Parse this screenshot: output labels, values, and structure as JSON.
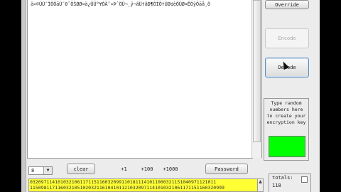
{
  "editor": {
    "content_line": "ä»©ÜÜ˜ÏÕÕāÜ˜θˆÕŠØØ¤ä¿ÜÜ°¥ÒÃ˜»ÞˆÖÜ¬¸ÿ¬ãÜ†ãÐ¶ÕÏÕ†ÜØ¢èÖÜØ¤ÊÖÿÕāå¸ð"
  },
  "buttons": {
    "override": "Override",
    "encode": "Encode",
    "decode": "Decode",
    "clear": "clear",
    "plus1": "+1",
    "plus100": "+100",
    "plus1000": "+1000",
    "password": "Password"
  },
  "key_panel": {
    "instruction": "Type random numbers here to create your encryption key",
    "swatch_color": "#00ff00"
  },
  "combo": {
    "selected": "8"
  },
  "hex_field": {
    "line1": "0320971141010321061171151160320991101811141011000321151040971121011",
    "line2": "1150981171160321051020321161041011210320971141010321061171151160320999"
  },
  "totals": {
    "label": "totals:",
    "value": "118"
  }
}
